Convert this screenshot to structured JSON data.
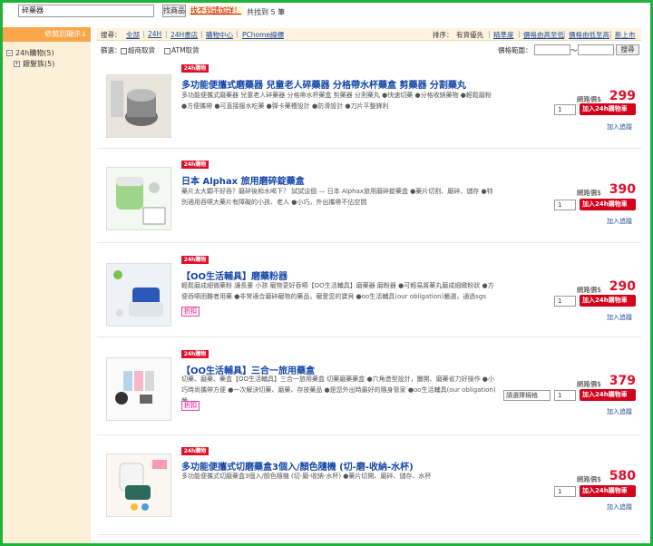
{
  "search": {
    "value": "碎藥器",
    "button": "找商品",
    "adv": "找不到請加詳！",
    "count": "共找到 5 筆"
  },
  "sidebar": {
    "header": "依館別顯示↓",
    "root": "24h購物(5)",
    "child": "銀髮族(5)"
  },
  "filter": {
    "label": "搜尋：",
    "links": [
      "全部",
      "24H",
      "24H書店",
      "購物中心",
      "PChome線標"
    ],
    "sort_label": "排序：",
    "sort": [
      "有貨優先",
      "精準度",
      "價格由高至低",
      "價格由低至高",
      "新上市"
    ]
  },
  "check": {
    "label": "篩選：",
    "opt1": "超商取貨",
    "opt2": "ATM取貨",
    "price_range": "價格範圍：",
    "tilde": "～",
    "go": "搜尋"
  },
  "labels": {
    "price": "網路價$",
    "qty": "1",
    "cart": "加入24h購物車",
    "track": "加入追蹤",
    "badge": "24h購物",
    "promo": "折扣",
    "spec": "請選擇規格"
  },
  "products": [
    {
      "title": "多功能便攜式磨藥器 兒童老人碎藥器 分格帶水杯藥盒 剪藥器 分割藥丸",
      "desc": "多功能便攜式磨藥器 兒童老人碎藥器 分格帶水杯藥盒 剪藥器 分割藥丸 ●快速切藥 ●分格收納藥物 ●輕鬆磨粉 ●方便攜帶 ●可直接服水吃藥 ●彈卡藥槽設計 ●防滑設計 ●刀片平整鋒利",
      "price": "299"
    },
    {
      "title": "日本 Alphax 旅用磨碎錠藥盒",
      "desc": "藥片太大顆不好吞？磨碎後和水喝下？ 試試這個 — 日本 Alphax旅用磨碎錠藥盒 ●藥片切割、磨碎、儲存 ●特別適用吞嚥大藥片有障礙的小孩、老人 ●小巧，外出攜帶不佔空間",
      "price": "390"
    },
    {
      "title": "【OO生活輔具】磨藥粉器",
      "desc": "輕鬆磨成細微藥粉 讓長輩 小孩 寵物更好吞嚥【OO生活輔具】磨藥器 磨粉器 ●可輕易將藥丸磨成細緻粉狀 ●方便吞嚥困難者用藥 ●非常適合磨碎寵物的藥品，寵愛您的寶貝 ●oo生活輔具(our obligation)嚴選，通過sgs",
      "price": "290"
    },
    {
      "title": "【OO生活輔具】三合一旅用藥盒",
      "desc": "切藥、磨藥、藥盒【OO生活輔具】三合一旅用藥盒 切藥磨藥藥盒 ●穴角造型設計，闔開、磨藥省力好操作 ●小巧時尚攜帶方便 ●一次解決切藥、磨藥、存放藥品 ●是您外出時最好的隨身管家 ●oo生活輔具(our obligation)嚴",
      "price": "379"
    },
    {
      "title": "多功能便攜式切磨藥盒3個入/顏色隨機 (切-磨-收納-水杯)",
      "desc": "多功能便攜式切磨藥盒3個入/顏色隨機 (切-磨-收納-水杯) ●藥片切開、磨碎、儲存、水杯",
      "price": "580"
    }
  ]
}
